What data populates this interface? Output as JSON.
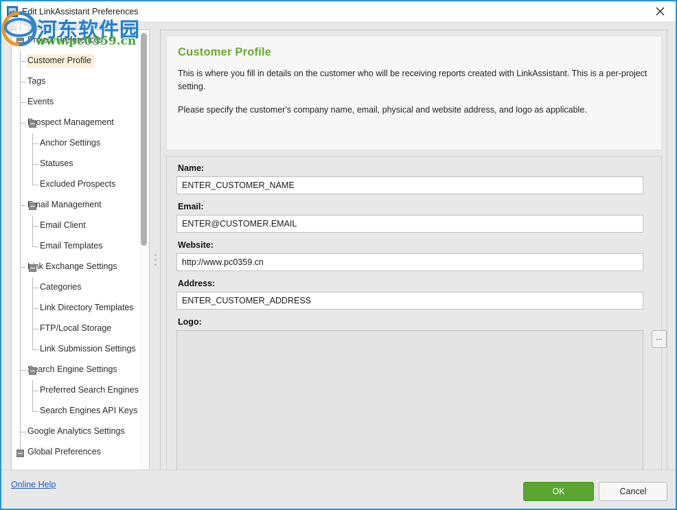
{
  "window": {
    "title": "Edit LinkAssistant Preferences",
    "app_icon": "linkassistant-app-icon",
    "close_icon": "close-icon",
    "border_color": "#2196d9"
  },
  "watermark": {
    "brand_cn": "河东软件园",
    "url": "www.pc0359.cn",
    "logo_icon": "pc0359-ring-logo",
    "brand_color": "#1f7fd4",
    "url_color": "#3fa535"
  },
  "sidebar": {
    "vscroll_icon": "vertical-scrollbar",
    "hscroll_icon": "horizontal-scrollbar",
    "splitter_icon": "splitter-grip-dots",
    "items": [
      {
        "label": "Project Preferences",
        "level": 0,
        "expander": "minus",
        "selected": false
      },
      {
        "label": "Customer Profile",
        "level": 1,
        "expander": "none",
        "selected": true
      },
      {
        "label": "Tags",
        "level": 1,
        "expander": "none",
        "selected": false
      },
      {
        "label": "Events",
        "level": 1,
        "expander": "none",
        "selected": false
      },
      {
        "label": "Prospect Management",
        "level": 1,
        "expander": "minus",
        "selected": false
      },
      {
        "label": "Anchor Settings",
        "level": 2,
        "expander": "none",
        "selected": false
      },
      {
        "label": "Statuses",
        "level": 2,
        "expander": "none",
        "selected": false
      },
      {
        "label": "Excluded Prospects",
        "level": 2,
        "expander": "none",
        "selected": false
      },
      {
        "label": "Email Management",
        "level": 1,
        "expander": "minus",
        "selected": false
      },
      {
        "label": "Email Client",
        "level": 2,
        "expander": "none",
        "selected": false
      },
      {
        "label": "Email Templates",
        "level": 2,
        "expander": "none",
        "selected": false
      },
      {
        "label": "Link Exchange Settings",
        "level": 1,
        "expander": "minus",
        "selected": false
      },
      {
        "label": "Categories",
        "level": 2,
        "expander": "none",
        "selected": false
      },
      {
        "label": "Link Directory Templates",
        "level": 2,
        "expander": "none",
        "selected": false
      },
      {
        "label": "FTP/Local Storage",
        "level": 2,
        "expander": "none",
        "selected": false
      },
      {
        "label": "Link Submission Settings",
        "level": 2,
        "expander": "none",
        "selected": false
      },
      {
        "label": "Search Engine Settings",
        "level": 1,
        "expander": "minus",
        "selected": false
      },
      {
        "label": "Preferred Search Engines",
        "level": 2,
        "expander": "none",
        "selected": false
      },
      {
        "label": "Search Engines API Keys",
        "level": 2,
        "expander": "none",
        "selected": false
      },
      {
        "label": "Google Analytics Settings",
        "level": 1,
        "expander": "none",
        "selected": false
      },
      {
        "label": "Global Preferences",
        "level": 0,
        "expander": "minus",
        "selected": false
      }
    ]
  },
  "main": {
    "title": "Customer Profile",
    "title_color": "#6aa82e",
    "description_1": "This is where you fill in details on the customer who will be receiving reports created with LinkAssistant. This is a per-project setting.",
    "description_2": "Please specify the customer's company name, email, physical and website address, and logo as applicable.",
    "fields": [
      {
        "label": "Name:",
        "value": "ENTER_CUSTOMER_NAME",
        "name": "customer-name-input"
      },
      {
        "label": "Email:",
        "value": "ENTER@CUSTOMER.EMAIL",
        "name": "customer-email-input"
      },
      {
        "label": "Website:",
        "value": "http://www.pc0359.cn",
        "name": "customer-website-input"
      },
      {
        "label": "Address:",
        "value": "ENTER_CUSTOMER_ADDRESS",
        "name": "customer-address-input"
      }
    ],
    "logo": {
      "label": "Logo:",
      "value": "",
      "browse_label": "...",
      "browse_icon": "ellipsis-browse-icon"
    }
  },
  "footer": {
    "online_help": "Online Help",
    "ok_label": "OK",
    "cancel_label": "Cancel",
    "ok_color": "#5aa630"
  }
}
